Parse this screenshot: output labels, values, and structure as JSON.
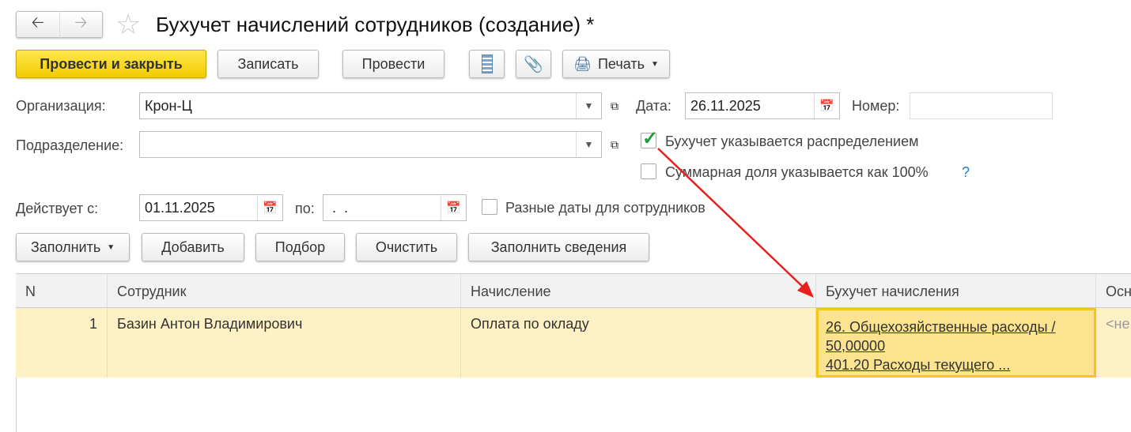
{
  "title": "Бухучет начислений сотрудников (создание) *",
  "toolbar": {
    "post_close": "Провести и закрыть",
    "save": "Записать",
    "post": "Провести",
    "print": "Печать"
  },
  "form": {
    "org_label": "Организация:",
    "org_value": "Крон-Ц",
    "date_label": "Дата:",
    "date_value": "26.11.2025",
    "number_label": "Номер:",
    "number_value": "",
    "dept_label": "Подразделение:",
    "dept_value": "",
    "distribution_label": "Бухучет указывается распределением",
    "distribution_checked": true,
    "share_label": "Суммарная доля указывается как 100%",
    "share_help": "?",
    "from_label": "Действует с:",
    "from_value": "01.11.2025",
    "to_label": "по:",
    "to_value": " .  .",
    "diff_dates_label": "Разные даты для сотрудников"
  },
  "table_toolbar": {
    "fill": "Заполнить",
    "add": "Добавить",
    "pick": "Подбор",
    "clear": "Очистить",
    "fill_info": "Заполнить сведения"
  },
  "table": {
    "columns": [
      "N",
      "Сотрудник",
      "Начисление",
      "Бухучет начисления",
      "Осн"
    ],
    "rows": [
      {
        "n": "1",
        "employee": "Базин Антон Владимирович",
        "accrual": "Оплата по окладу",
        "acc_line1": "26. Общехозяйственные расходы /",
        "acc_line2": "50,00000",
        "acc_line3": "401.20 Расходы текущего ...",
        "basis": "<не"
      }
    ]
  },
  "colors": {
    "accent": "#f2cc00",
    "row_bg": "#fdf1c5",
    "selected_cell": "#fbe38f",
    "arrow": "#e8201c",
    "check": "#1e9e3a"
  }
}
